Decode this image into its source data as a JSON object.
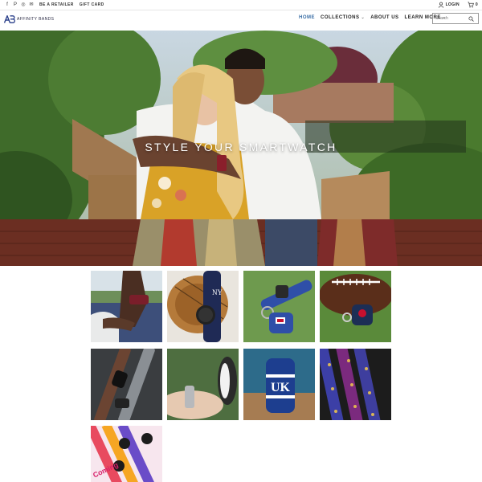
{
  "topbar": {
    "social_icons": [
      "facebook-icon",
      "pinterest-icon",
      "instagram-icon",
      "email-icon"
    ],
    "social_glyphs": [
      "f",
      "P",
      "◎",
      "✉"
    ],
    "links": [
      "BE A RETAILER",
      "GIFT CARD"
    ],
    "login_label": "LOGIN",
    "cart_count": "0"
  },
  "header": {
    "brand": "AFFINITY BANDS",
    "nav": [
      {
        "label": "HOME",
        "active": true
      },
      {
        "label": "COLLECTIONS",
        "dropdown": true
      },
      {
        "label": "ABOUT US"
      },
      {
        "label": "LEARN MORE",
        "dropdown": true
      }
    ],
    "search_placeholder": "Search"
  },
  "hero": {
    "title": "STYLE YOUR SMARTWATCH"
  },
  "coming_soon_text": "Coming",
  "colors": {
    "accent": "#3a6ea5",
    "nav_text": "#222222",
    "band_navy": "#2f4fa8",
    "band_red": "#8a1f2b"
  }
}
